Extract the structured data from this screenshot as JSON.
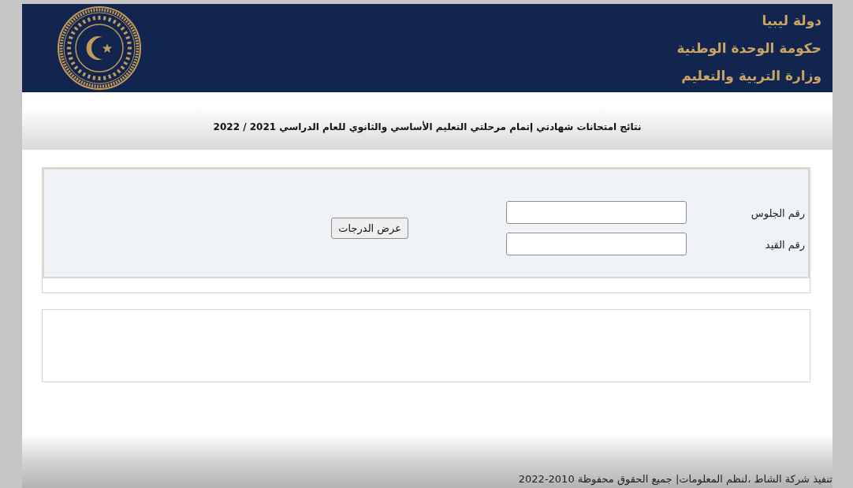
{
  "header": {
    "lines": [
      "دولة ليبيا",
      "حكومة الوحدة الوطنية",
      "وزارة التربية والتعليم"
    ]
  },
  "title": "نتائج امتحانات شهادتي إتمام مرحلتي التعليم الأساسي والثانوي للعام الدراسي 2021 / 2022",
  "search_form": {
    "fields": [
      {
        "label": "رقم الجلوس"
      },
      {
        "label": "رقم القيد"
      }
    ],
    "button": "عرض الدرجات"
  },
  "footer": "تنفيذ شركة الشاط ،لنظم المعلومات| جميع الحقوق محفوظة 2010-2022"
}
